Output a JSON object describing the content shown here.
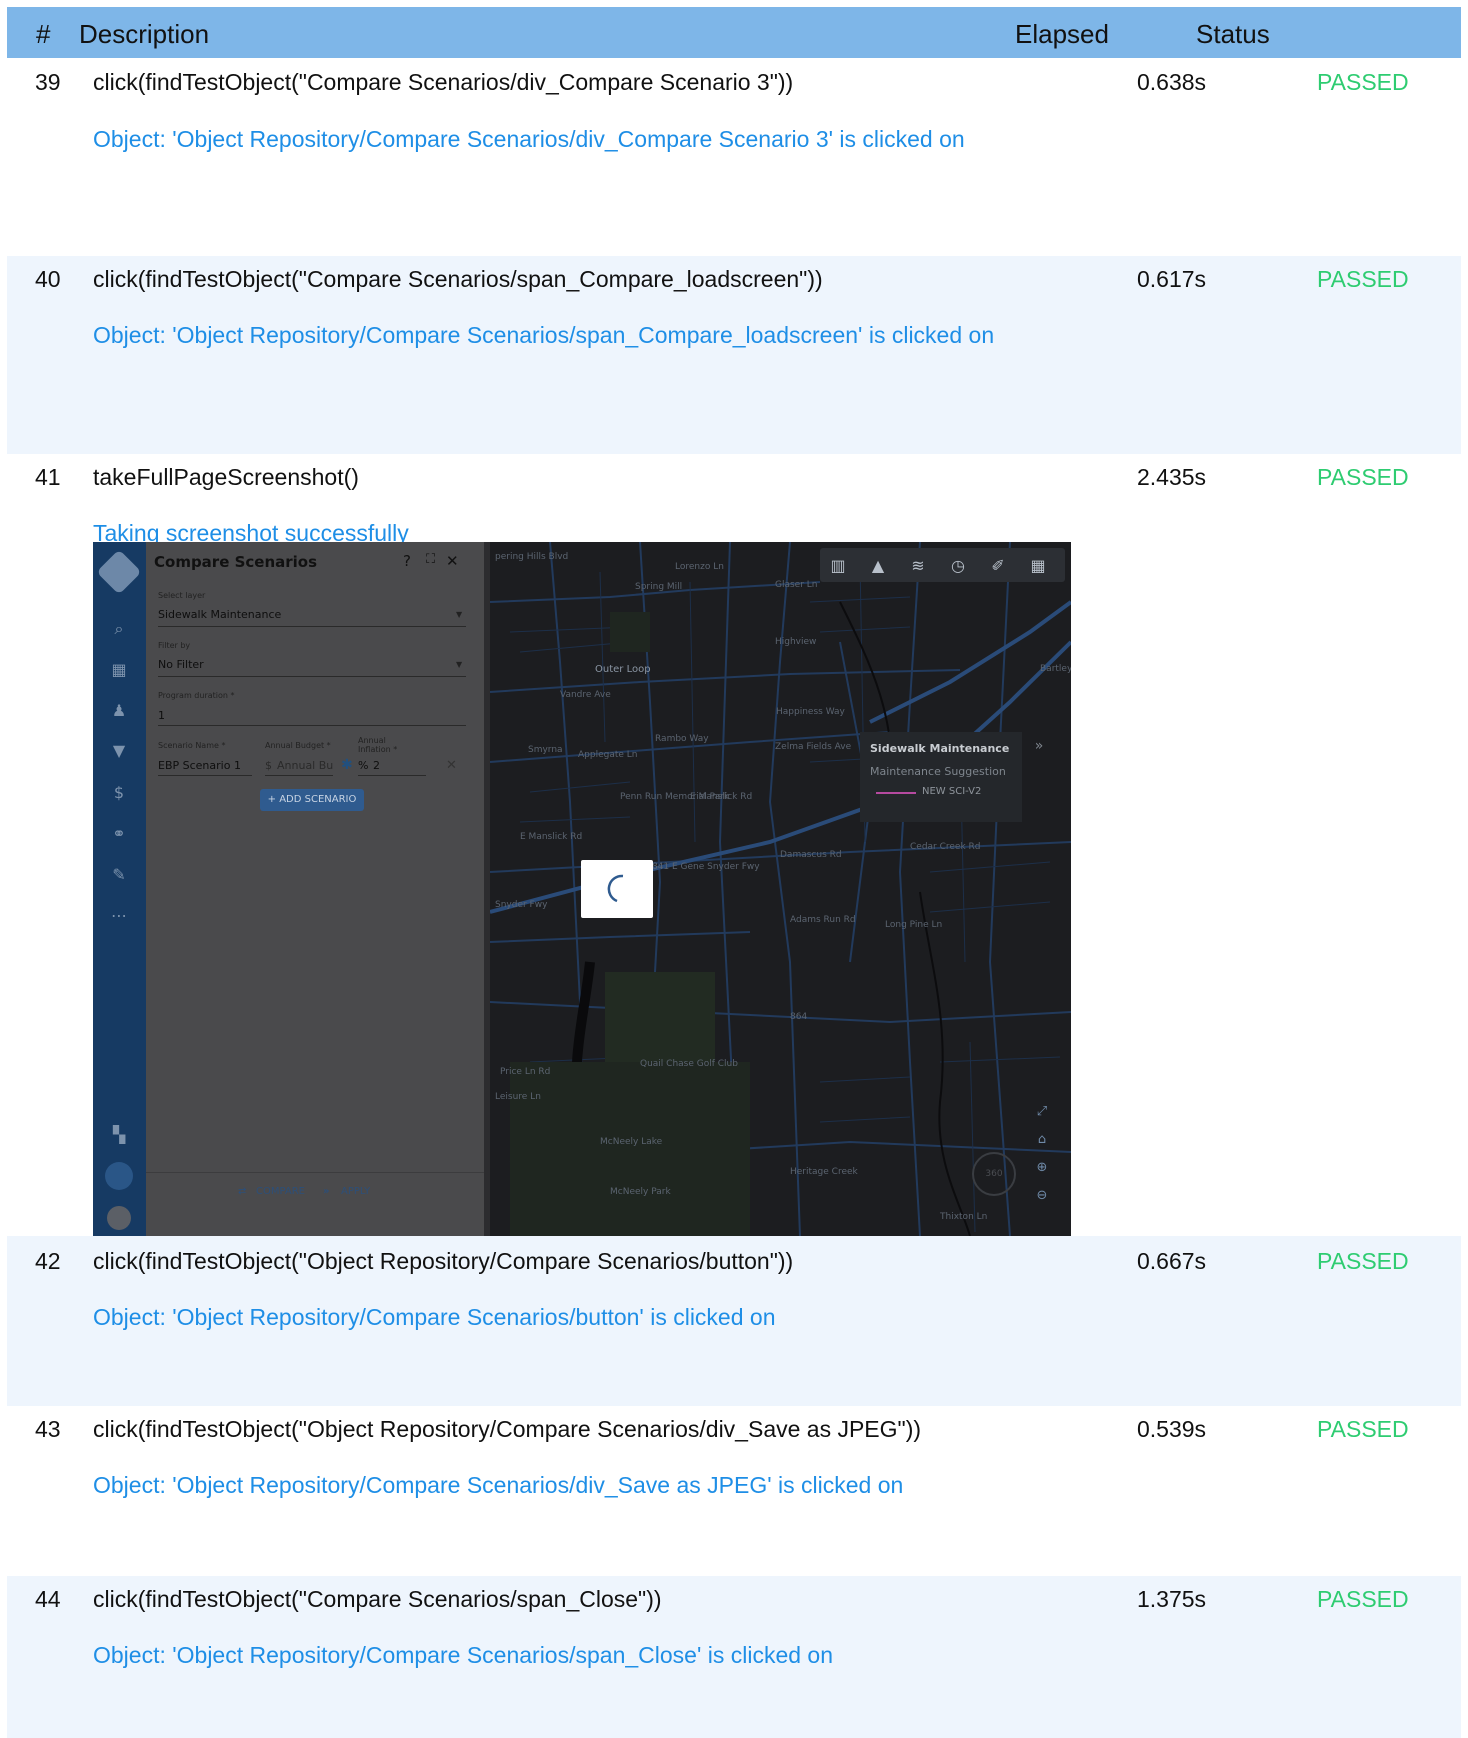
{
  "header": {
    "num": "#",
    "description": "Description",
    "elapsed": "Elapsed",
    "status": "Status"
  },
  "rows": [
    {
      "num": "39",
      "description": "click(findTestObject(\"Compare Scenarios/div_Compare Scenario 3\"))",
      "elapsed": "0.638s",
      "status": "PASSED",
      "message": "Object: 'Object Repository/Compare Scenarios/div_Compare Scenario 3' is clicked on"
    },
    {
      "num": "40",
      "description": "click(findTestObject(\"Compare Scenarios/span_Compare_loadscreen\"))",
      "elapsed": "0.617s",
      "status": "PASSED",
      "message": "Object: 'Object Repository/Compare Scenarios/span_Compare_loadscreen' is clicked on"
    },
    {
      "num": "41",
      "description": "takeFullPageScreenshot()",
      "elapsed": "2.435s",
      "status": "PASSED",
      "message": "Taking screenshot successfully"
    },
    {
      "num": "42",
      "description": "click(findTestObject(\"Object Repository/Compare Scenarios/button\"))",
      "elapsed": "0.667s",
      "status": "PASSED",
      "message": "Object: 'Object Repository/Compare Scenarios/button' is clicked on"
    },
    {
      "num": "43",
      "description": "click(findTestObject(\"Object Repository/Compare Scenarios/div_Save as JPEG\"))",
      "elapsed": "0.539s",
      "status": "PASSED",
      "message": "Object: 'Object Repository/Compare Scenarios/div_Save as JPEG' is clicked on"
    },
    {
      "num": "44",
      "description": "click(findTestObject(\"Compare Scenarios/span_Close\"))",
      "elapsed": "1.375s",
      "status": "PASSED",
      "message": "Object: 'Object Repository/Compare Scenarios/span_Close' is clicked on"
    }
  ],
  "screenshot": {
    "panel_title": "Compare Scenarios",
    "help_icon": "?",
    "expand_icon": "⛶",
    "close_icon": "✕",
    "select_layer_label": "Select layer",
    "select_layer_value": "Sidewalk Maintenance",
    "filter_label": "Filter by",
    "filter_value": "No Filter",
    "duration_label": "Program duration *",
    "duration_value": "1",
    "scenario_name_label": "Scenario Name *",
    "scenario_name_value": "EBP Scenario 1",
    "budget_label": "Annual Budget *",
    "budget_prefix": "$",
    "budget_placeholder": "Annual Bu",
    "inflation_label_1": "Annual",
    "inflation_label_2": "Inflation *",
    "inflation_prefix": "%",
    "inflation_value": "2",
    "add_scenario_label": "+ ADD SCENARIO",
    "compare_label": "COMPARE",
    "apply_label": "APPLY",
    "legend_title": "Sidewalk Maintenance",
    "legend_subtitle": "Maintenance Suggestion",
    "legend_item": "NEW SCI-V2",
    "map_labels": {
      "spring_mill": "Spring Mill",
      "outer_loop": "Outer Loop",
      "highview": "Highview",
      "glaser_ln": "Glaser Ln",
      "lorenzo_ln": "Lorenzo Ln",
      "vandre_ave": "Vandre Ave",
      "smyrna": "Smyrna",
      "applegate_ln": "Applegate Ln",
      "rambo_way": "Rambo Way",
      "happiness_way": "Happiness Way",
      "zelma_fields": "Zelma Fields Ave",
      "gene_snyder": "Gene Snyder Fwy",
      "e_manslick_rd": "E Manslick Rd",
      "penn_run": "Penn Run Memorial Park",
      "vaughn_mill_rd": "Vaughn Mill Rd",
      "damascus_rd": "Damascus Rd",
      "cedar_creek_rd": "Cedar Creek Rd",
      "rocky_ln": "Rocky Ln",
      "adams_run_rd": "Adams Run Rd",
      "long_pine_ln": "Long Pine Ln",
      "pennsylvania_run_rd": "Pennsylvania Run Rd",
      "quail_chase": "Quail Chase Golf Club",
      "price_ln_rd": "Price Ln Rd",
      "leisure_ln": "Leisure Ln",
      "mcneely_lake": "McNeely Lake",
      "mcneely_park": "McNeely Park",
      "heritage_creek": "Heritage Creek",
      "thixton_ln": "Thixton Ln",
      "bartley": "Bartley",
      "route_864": "864",
      "ky841": "KY 841 E Gene Snyder Fwy",
      "snyder_fwy": "Snyder Fwy",
      "park_lake_dr": "Park Lake Dr",
      "compass": "360"
    }
  }
}
